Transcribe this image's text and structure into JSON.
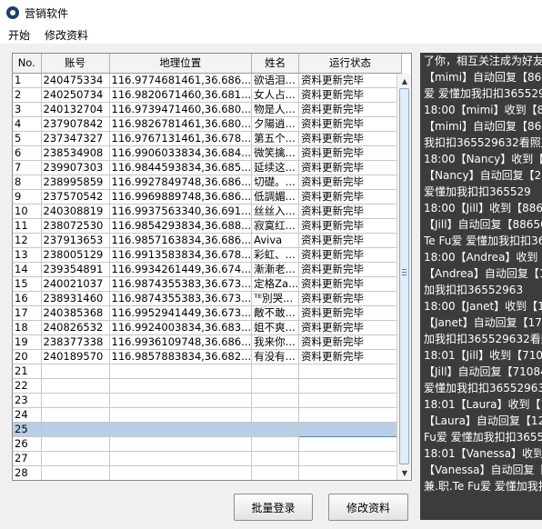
{
  "window": {
    "title": "营销软件"
  },
  "menu": [
    {
      "label": "开始"
    },
    {
      "label": "修改资料"
    }
  ],
  "table": {
    "columns": [
      "No.",
      "账号",
      "地理位置",
      "姓名",
      "运行状态"
    ],
    "rows": [
      [
        "1",
        "240475334",
        "116.9774681461,36.686...",
        "欲语泪...",
        "资料更新完毕"
      ],
      [
        "2",
        "240250734",
        "116.9820671460,36.681...",
        "女人占...",
        "资料更新完毕"
      ],
      [
        "3",
        "240132704",
        "116.9739471460,36.680...",
        "物是人...",
        "资料更新完毕"
      ],
      [
        "4",
        "237907842",
        "116.9826781461,36.680...",
        "夕陽逍...",
        "资料更新完毕"
      ],
      [
        "5",
        "237347327",
        "116.9767131461,36.678...",
        "第五个...",
        "资料更新完毕"
      ],
      [
        "6",
        "238534908",
        "116.9906033834,36.684...",
        "微笑擒...",
        "资料更新完毕"
      ],
      [
        "7",
        "239907303",
        "116.9844593834,36.685...",
        "延续这...",
        "资料更新完毕"
      ],
      [
        "8",
        "238995859",
        "116.9927849748,36.686...",
        "切礎。...",
        "资料更新完毕"
      ],
      [
        "9",
        "237570542",
        "116.9969889748,36.686...",
        "低調媚...",
        "资料更新完毕"
      ],
      [
        "10",
        "240308819",
        "116.9937563340,36.691...",
        "丝丝入...",
        "资料更新完毕"
      ],
      [
        "11",
        "238072530",
        "116.9854293834,36.688...",
        "寂寞红...",
        "资料更新完毕"
      ],
      [
        "12",
        "237913653",
        "116.9857163834,36.686...",
        "Aviva",
        "资料更新完毕"
      ],
      [
        "13",
        "238005129",
        "116.9913583834,36.678...",
        "彩虹、...",
        "资料更新完毕"
      ],
      [
        "14",
        "239354891",
        "116.9934261449,36.674...",
        "漸漸老...",
        "资料更新完毕"
      ],
      [
        "15",
        "240021037",
        "116.9874355383,36.673...",
        "定格Za...",
        "资料更新完毕"
      ],
      [
        "16",
        "238931460",
        "116.9874355383,36.673...",
        "ᵀᴱ別哭...",
        "资料更新完毕"
      ],
      [
        "17",
        "240385368",
        "116.9952941449,36.673...",
        "敵不敢...",
        "资料更新完毕"
      ],
      [
        "18",
        "240826532",
        "116.9924003834,36.683...",
        "姐不爽...",
        "资料更新完毕"
      ],
      [
        "19",
        "238377338",
        "116.9936109748,36.686...",
        "我来你...",
        "资料更新完毕"
      ],
      [
        "20",
        "240189570",
        "116.9857883834,36.682...",
        "有没有...",
        "资料更新完毕"
      ],
      [
        "21",
        "",
        "",
        "",
        ""
      ],
      [
        "22",
        "",
        "",
        "",
        ""
      ],
      [
        "23",
        "",
        "",
        "",
        ""
      ],
      [
        "24",
        "",
        "",
        "",
        ""
      ],
      [
        "25",
        "",
        "",
        "",
        ""
      ],
      [
        "26",
        "",
        "",
        "",
        ""
      ],
      [
        "27",
        "",
        "",
        "",
        ""
      ],
      [
        "28",
        "",
        "",
        "",
        ""
      ]
    ],
    "selected_row": "25"
  },
  "buttons": {
    "batch_login": "批量登录",
    "edit_profile": "修改资料"
  },
  "log": [
    "17:59【mimi】收到【8",
    "了你，相互关注成为好友",
    "【mimi】自动回复【864",
    "爱 爱懂加我扣扣365529",
    "18:00【mimi】收到【8",
    "【mimi】自动回复【864",
    "我扣扣365529632看照片",
    "18:00【Nancy】收到【2",
    "【Nancy】自动回复【22",
    "爱懂加我扣扣365529",
    "18:00【Jill】收到【886",
    "【Jill】自动回复【88650",
    "Te Fu爱 爱懂加我扣扣36",
    "18:00【Andrea】收到【",
    "【Andrea】自动回复【1",
    "加我扣扣36552963",
    "18:00【Janet】收到【17",
    "【Janet】自动回复【17",
    "加我扣扣365529632看照",
    "18:01【Jill】收到【7108",
    "【Jill】自动回复【71084",
    "爱懂加我扣扣36552963",
    "18:01【Laura】收到【1",
    "【Laura】自动回复【12",
    "Fu爱 爱懂加我扣扣3655",
    "18:01【Vanessa】收到",
    "【Vanessa】自动回复【",
    "兼.职.Te Fu爱 爱懂加我扣"
  ]
}
